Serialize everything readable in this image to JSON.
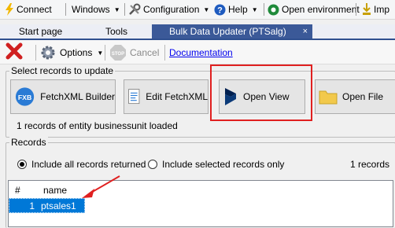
{
  "menubar": {
    "connect": "Connect",
    "windows": "Windows",
    "configuration": "Configuration",
    "help": "Help",
    "open_environment": "Open environment",
    "imp": "Imp"
  },
  "tabs": [
    {
      "label": "Start page"
    },
    {
      "label": "Tools"
    },
    {
      "label": "Bulk Data Updater (PTSalg)",
      "close": "×"
    }
  ],
  "toolbar": {
    "options": "Options",
    "cancel": "Cancel",
    "documentation": "Documentation"
  },
  "select_records": {
    "legend": "Select records to update",
    "buttons": {
      "fetchxml_builder": "FetchXML Builder",
      "edit_fetchxml": "Edit FetchXML",
      "open_view": "Open View",
      "open_file": "Open File"
    },
    "status": "1 records of entity businessunit loaded"
  },
  "records": {
    "legend": "Records",
    "include_all": "Include all records returned",
    "include_selected": "Include selected records only",
    "count": "1 records",
    "columns": [
      "#",
      "name"
    ],
    "rows": [
      {
        "num": "1",
        "name": "ptsales1"
      }
    ]
  },
  "icons": {
    "fxb_glyph": "FXB"
  },
  "colors": {
    "accent": "#3b5998",
    "annotation_red": "#e02020",
    "link": "#0000ee",
    "selection": "#0078d7"
  }
}
